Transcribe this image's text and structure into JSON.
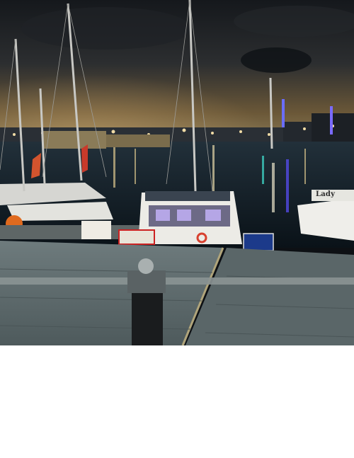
{
  "scene": {
    "boat_label": "Lady"
  },
  "colors": {
    "sky_top": "#1b1e22",
    "sky_glow": "#6b5838",
    "water": "#0f1a22",
    "deck": "#5d6a6c",
    "rail": "#7f8788"
  }
}
